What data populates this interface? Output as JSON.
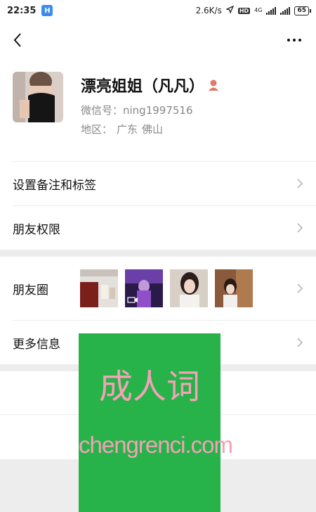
{
  "status_bar": {
    "time": "22:35",
    "app_badge": "H",
    "net_speed": "2.6K/s",
    "hd_label": "HD",
    "network_type": "4G",
    "battery": "65"
  },
  "profile": {
    "nickname": "漂亮姐姐（凡凡）",
    "wechat_id": "微信号：ning1997516",
    "region_label": "地区：",
    "region_province": "广东",
    "region_city": "佛山"
  },
  "menu": {
    "remark_tags": "设置备注和标签",
    "friend_permissions": "朋友权限",
    "moments": "朋友圈",
    "more_info": "更多信息"
  },
  "watermark": {
    "title": "成人词",
    "subtitle": "chengrenci.com"
  },
  "icons": {
    "back": "chevron-left-icon",
    "more": "more-dots-icon",
    "gender": "female-icon",
    "chevron": "chevron-right-icon"
  },
  "colors": {
    "watermark_bg": "#27b24a",
    "watermark_text": "#f2a3b6",
    "secondary_text": "#888888"
  }
}
